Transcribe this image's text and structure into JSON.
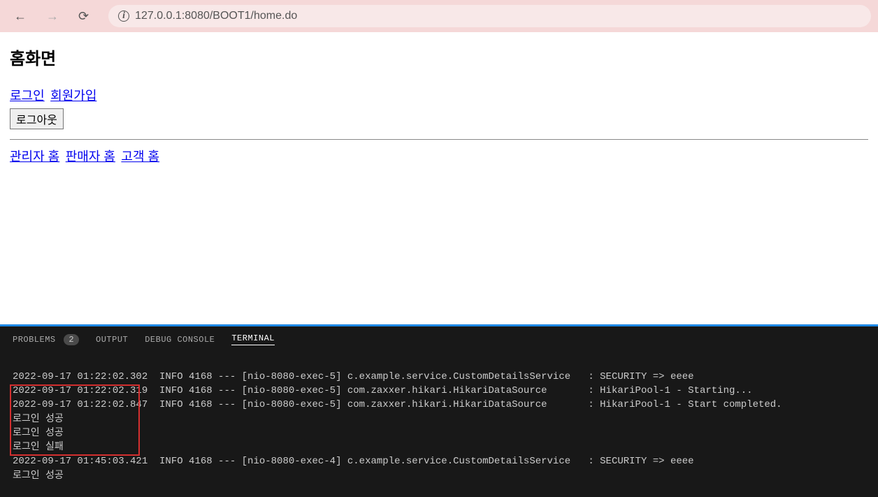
{
  "browser": {
    "url": "127.0.0.1:8080/BOOT1/home.do"
  },
  "page": {
    "title": "홈화면",
    "links": {
      "login": "로그인",
      "signup": "회원가입",
      "admin_home": "관리자 홈",
      "seller_home": "판매자 홈",
      "customer_home": "고객 홈"
    },
    "logout_btn": "로그아웃"
  },
  "terminal": {
    "tabs": {
      "problems": "PROBLEMS",
      "problems_count": "2",
      "output": "OUTPUT",
      "debug_console": "DEBUG CONSOLE",
      "terminal": "TERMINAL"
    },
    "lines": [
      "2022-09-17 01:22:02.302  INFO 4168 --- [nio-8080-exec-5] c.example.service.CustomDetailsService   : SECURITY => eeee",
      "2022-09-17 01:22:02.319  INFO 4168 --- [nio-8080-exec-5] com.zaxxer.hikari.HikariDataSource       : HikariPool-1 - Starting...",
      "2022-09-17 01:22:02.847  INFO 4168 --- [nio-8080-exec-5] com.zaxxer.hikari.HikariDataSource       : HikariPool-1 - Start completed.",
      "로그인 성공",
      "로그인 성공",
      "로그인 실패",
      "2022-09-17 01:45:03.421  INFO 4168 --- [nio-8080-exec-4] c.example.service.CustomDetailsService   : SECURITY => eeee",
      "로그인 성공"
    ]
  }
}
